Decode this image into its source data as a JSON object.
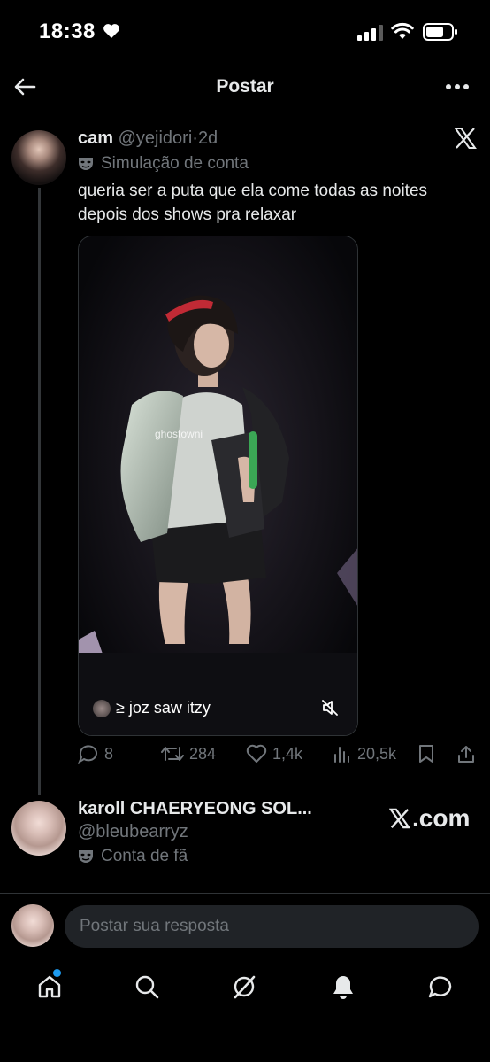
{
  "status_bar": {
    "time": "18:38"
  },
  "header": {
    "title": "Postar"
  },
  "post": {
    "author_name": "cam",
    "author_handle": "@yejidori",
    "separator": "·",
    "age": "2d",
    "account_label": "Simulação de conta",
    "text": "queria ser a puta que ela come todas as noites depois dos shows pra relaxar",
    "media": {
      "watermark": "ghostowni",
      "caption": "≥ joz saw itzy"
    },
    "stats": {
      "replies": "8",
      "reposts": "284",
      "likes": "1,4k",
      "views": "20,5k"
    }
  },
  "quoted_user": {
    "name": "karoll CHAERYEONG SOL...",
    "handle": "@bleubearryz",
    "account_label": "Conta de fã",
    "site": ".com"
  },
  "reply": {
    "placeholder": "Postar sua resposta"
  },
  "nav": {
    "items": [
      "home-icon",
      "search-icon",
      "grok-icon",
      "notifications-icon",
      "messages-icon"
    ],
    "accent": "#1d9bf0"
  },
  "colors": {
    "background": "#000000",
    "text": "#e7e9ea",
    "muted": "#71767b",
    "accent": "#1d9bf0"
  }
}
